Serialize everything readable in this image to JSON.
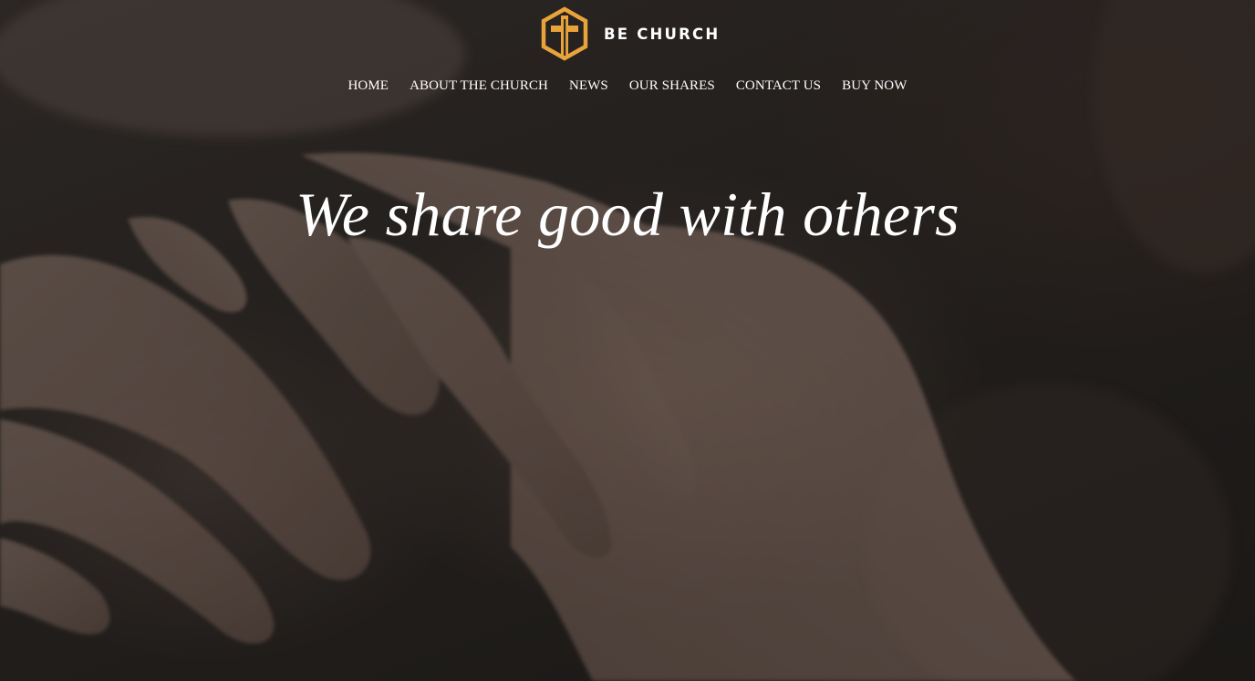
{
  "brand": {
    "name": "BE CHURCH",
    "logo_icon": "cross-hexagon-icon",
    "accent_color": "#E8A33A"
  },
  "nav": {
    "items": [
      {
        "label": "HOME"
      },
      {
        "label": "ABOUT THE CHURCH"
      },
      {
        "label": "NEWS"
      },
      {
        "label": "OUR SHARES"
      },
      {
        "label": "CONTACT US"
      },
      {
        "label": "BUY NOW"
      }
    ]
  },
  "hero": {
    "headline": "We share good with others",
    "background_image": "hands-holding-photo"
  }
}
